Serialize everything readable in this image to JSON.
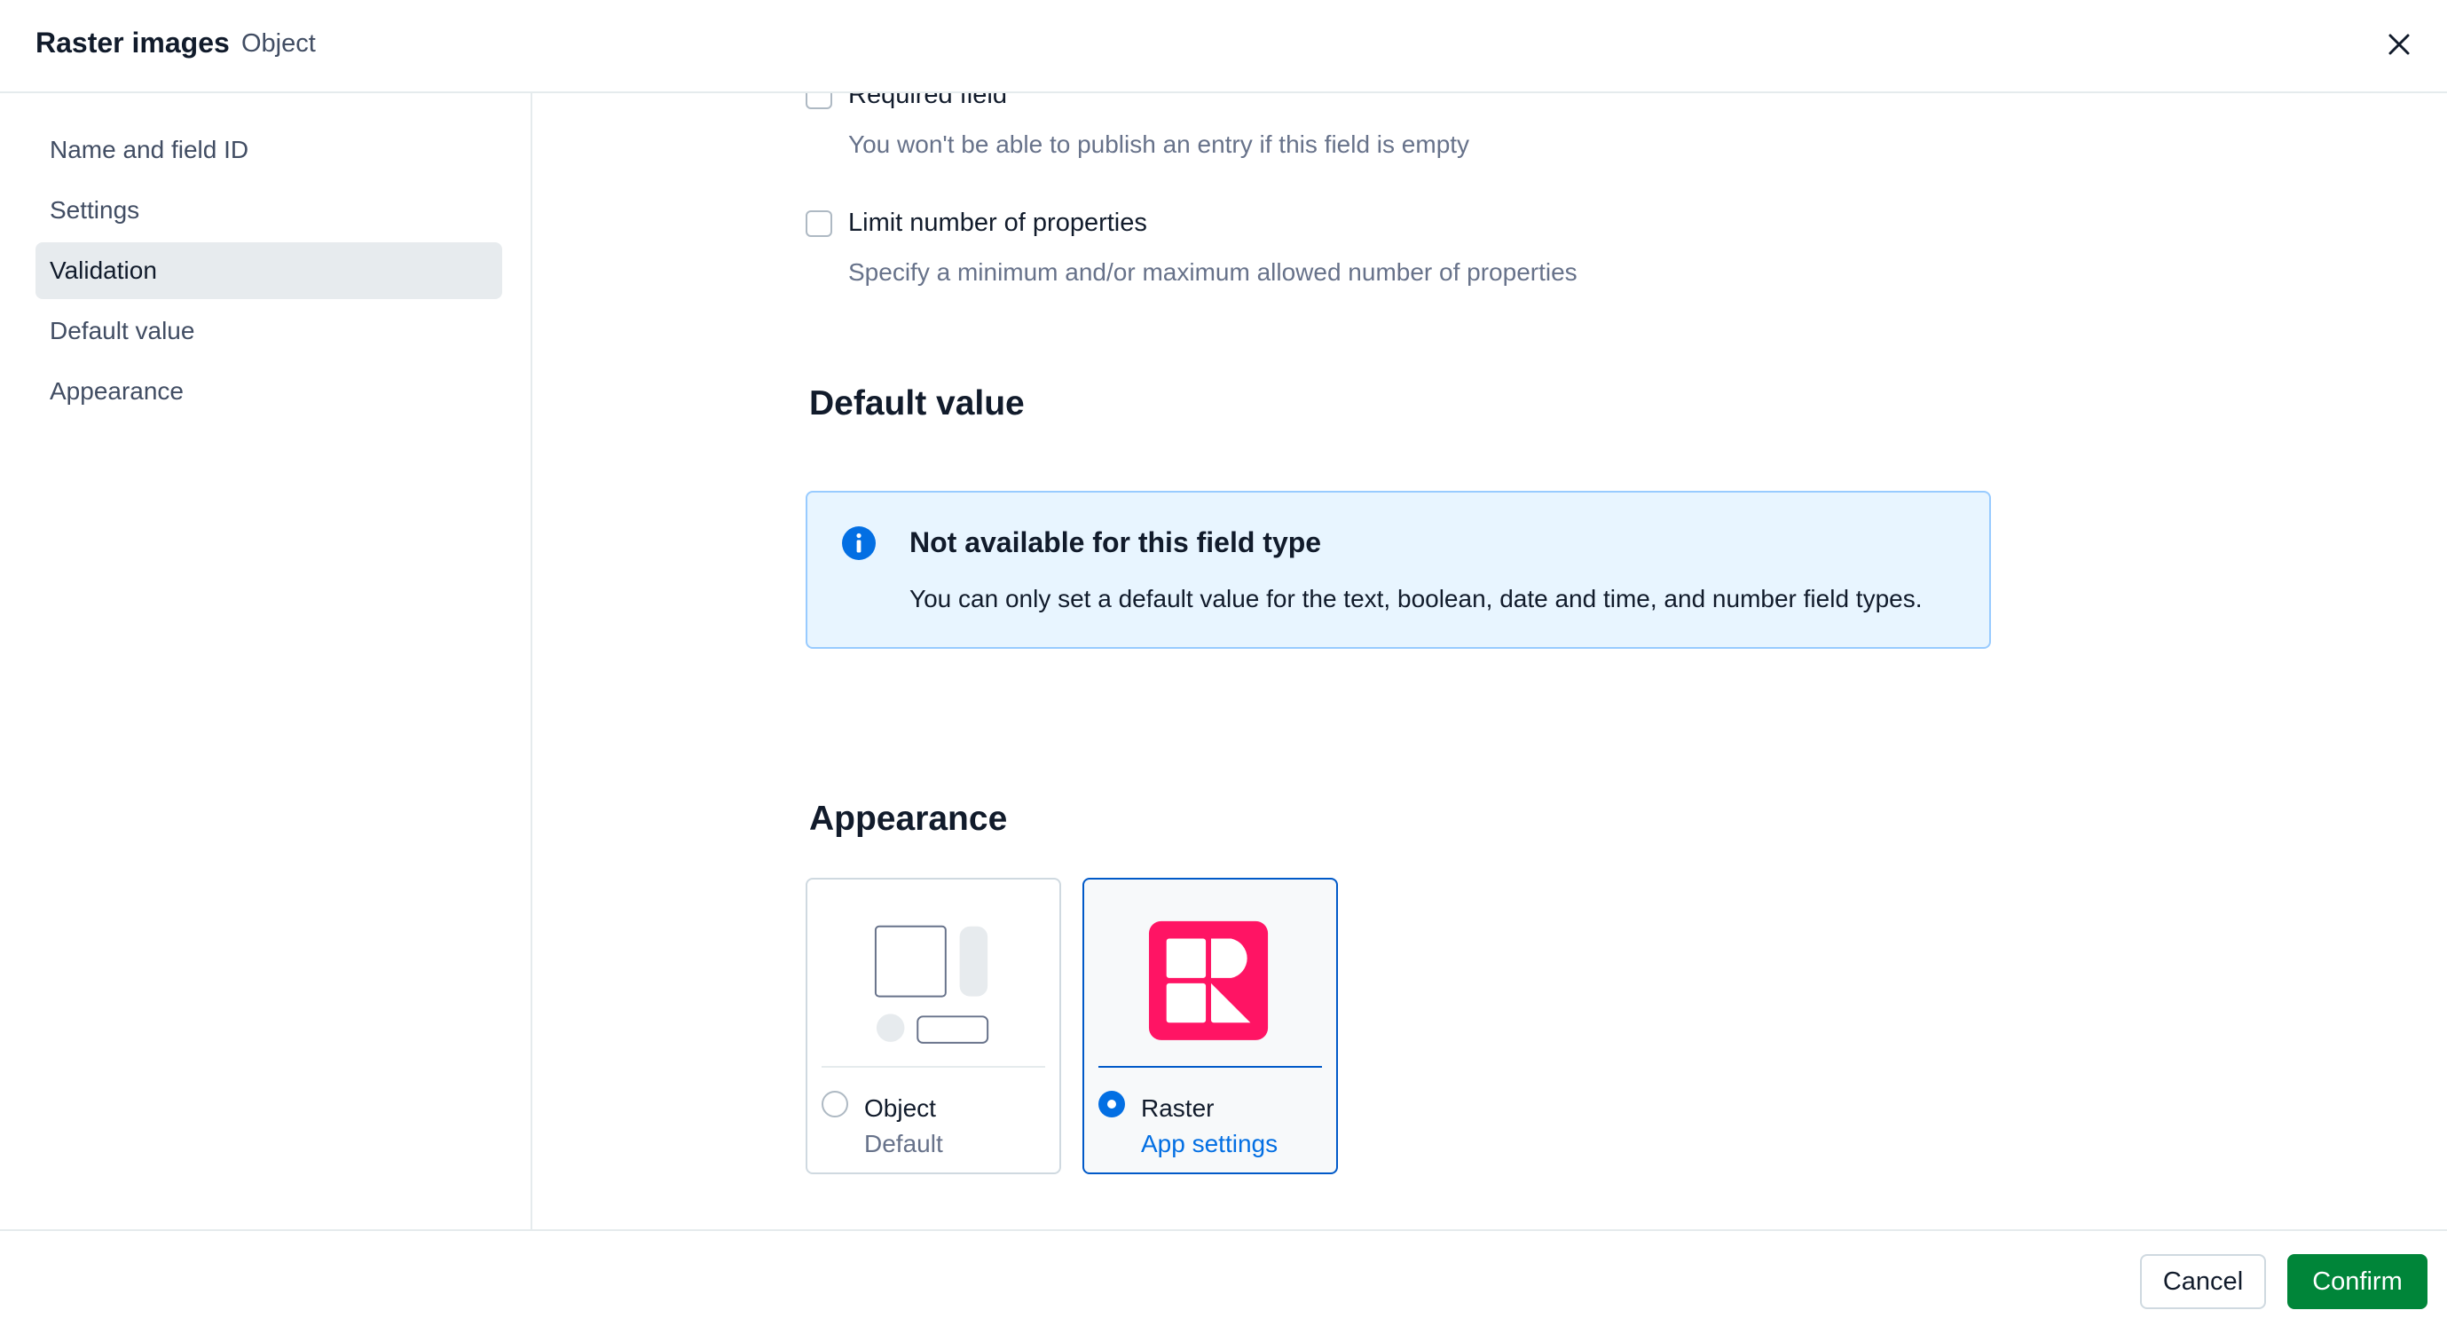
{
  "header": {
    "title": "Raster images",
    "subtitle": "Object",
    "close_icon": "close-icon"
  },
  "sidebar": {
    "items": [
      {
        "label": "Name and field ID",
        "active": false
      },
      {
        "label": "Settings",
        "active": false
      },
      {
        "label": "Validation",
        "active": true
      },
      {
        "label": "Default value",
        "active": false
      },
      {
        "label": "Appearance",
        "active": false
      }
    ]
  },
  "validation": {
    "required": {
      "label": "Required field",
      "help": "You won't be able to publish an entry if this field is empty",
      "checked": false
    },
    "limit": {
      "label": "Limit number of properties",
      "help": "Specify a minimum and/or maximum allowed number of properties",
      "checked": false
    }
  },
  "default_value": {
    "heading": "Default value",
    "note": {
      "icon": "info-icon",
      "title": "Not available for this field type",
      "text": "You can only set a default value for the text, boolean, date and time, and number field types."
    }
  },
  "appearance": {
    "heading": "Appearance",
    "options": [
      {
        "name": "Object",
        "sub": "Default",
        "selected": false,
        "icon": "object-widget-icon"
      },
      {
        "name": "Raster",
        "link": "App settings",
        "selected": true,
        "icon": "raster-logo-icon"
      }
    ]
  },
  "footer": {
    "cancel_label": "Cancel",
    "confirm_label": "Confirm"
  },
  "colors": {
    "primary": "#036fe3",
    "positive": "#008539",
    "raster_brand": "#ff1464",
    "note_bg": "#e8f5ff"
  }
}
